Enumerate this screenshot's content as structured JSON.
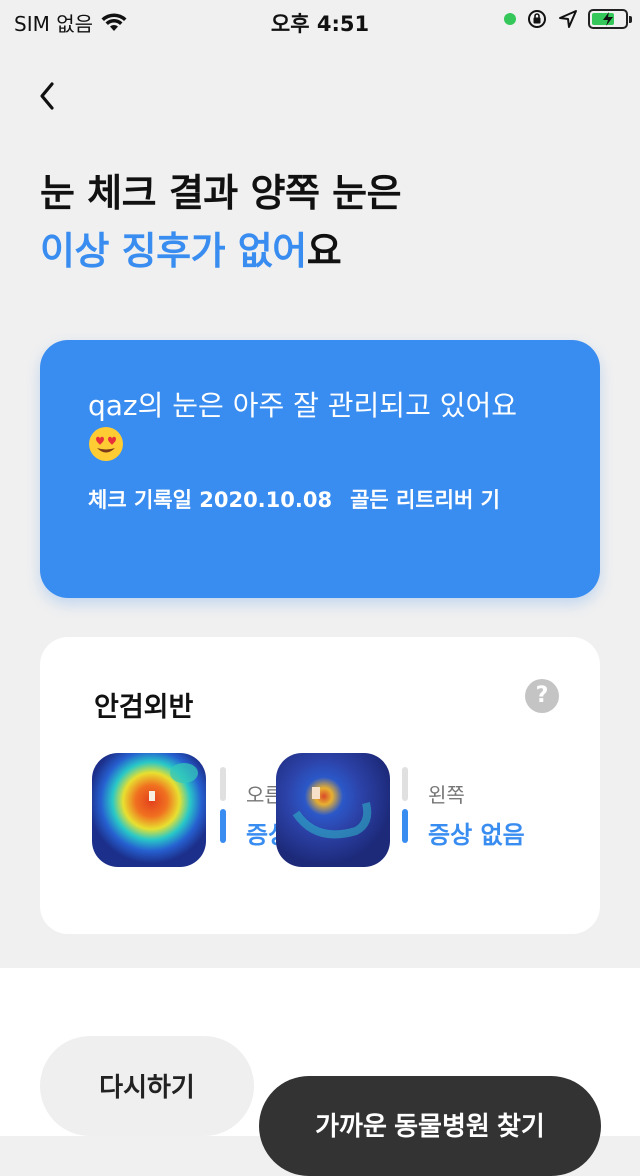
{
  "status_bar": {
    "carrier": "SIM 없음",
    "time": "오후 4:51",
    "icons": [
      "wifi-icon",
      "location-dot-icon",
      "orientation-lock-icon",
      "location-arrow-icon",
      "battery-charging-icon"
    ]
  },
  "nav": {
    "back_icon": "chevron-left-icon"
  },
  "headline": {
    "line1": "눈 체크 결과 양쪽 눈은",
    "line2_accent": "이상 징후가 없어",
    "line2_tail": "요"
  },
  "summary": {
    "message": "qaz의 눈은 아주 잘 관리되고 있어요",
    "emoji": "heart-eyes-emoji",
    "record_label": "체크 기록일",
    "record_date": "2020.10.08",
    "breed": "골든 리트리버 기"
  },
  "result": {
    "title": "안검외반",
    "help": "?",
    "right_eye": {
      "label": "오른",
      "status": "증상"
    },
    "left_eye": {
      "label": "왼쪽",
      "status": "증상 없음"
    }
  },
  "actions": {
    "retry_label": "다시하기",
    "find_hospital_label": "가까운 동물병원 찾기"
  },
  "colors": {
    "accent": "#3a8df0",
    "dark_button": "#333333",
    "background": "#f0f0f0"
  }
}
